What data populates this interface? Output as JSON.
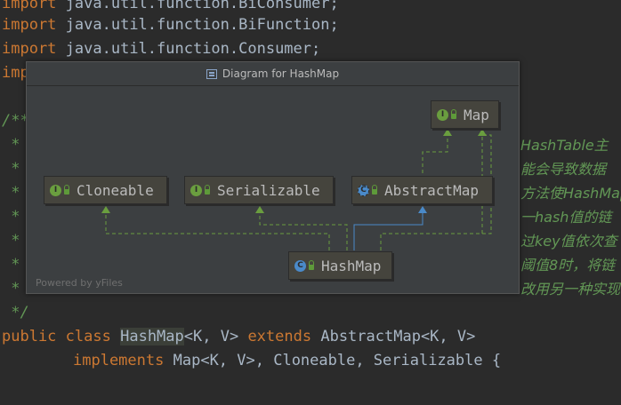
{
  "editor": {
    "imports": [
      {
        "kw": "import",
        "path": "java.util.function.BiConsumer;"
      },
      {
        "kw": "import",
        "path": "java.util.function.BiFunction;"
      },
      {
        "kw": "import",
        "path": "java.util.function.Consumer;"
      },
      {
        "kw": "imp",
        "path": ""
      }
    ],
    "comment_open": "/**",
    "comment_star": " *",
    "comment_close": " */",
    "comment_right": [
      "HashTable主",
      "能会导致数据",
      "方法使HashMap",
      "一hash值的链",
      "过key值依次查",
      "阈值8时，将链",
      "改用另一种实现"
    ],
    "decl1": {
      "kw1": "public",
      "kw2": "class",
      "name": "HashMap",
      "params": "<K, V>",
      "kw3": "extends",
      "parent": "AbstractMap",
      "parent_params": "<K, V>"
    },
    "decl2": {
      "kw": "implements",
      "iface1": "Map",
      "iface1_params": "<K, V>",
      "rest": ", Cloneable, Serializable {"
    }
  },
  "diagram": {
    "title": "Diagram for HashMap",
    "powered_by": "Powered by yFiles",
    "nodes": {
      "map": "Map",
      "cloneable": "Cloneable",
      "serializable": "Serializable",
      "abstractmap": "AbstractMap",
      "hashmap": "HashMap"
    },
    "badges": {
      "interface": "I",
      "class": "C",
      "abstract": "C"
    },
    "colors": {
      "interface_badge": "#6a9e3f",
      "class_badge": "#4a8ac9",
      "implements_edge": "#6a9e3f",
      "extends_edge": "#4a8ac9"
    }
  }
}
